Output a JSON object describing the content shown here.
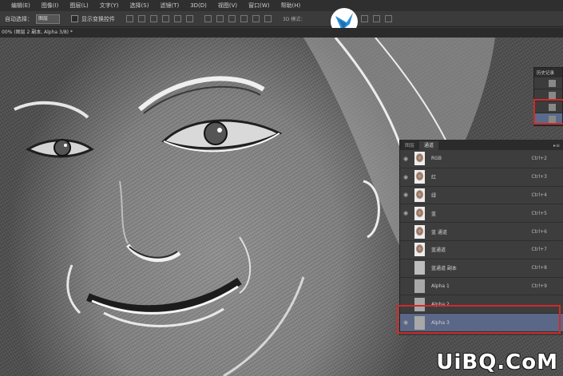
{
  "menu": {
    "items": [
      "编辑(E)",
      "图像(I)",
      "图层(L)",
      "文字(Y)",
      "选择(S)",
      "滤镜(T)",
      "3D(D)",
      "视图(V)",
      "窗口(W)",
      "帮助(H)"
    ]
  },
  "options": {
    "auto_select_label": "自动选择：",
    "auto_select_value": "图层",
    "show_transform_label": "显示变换控件",
    "mode_3d": "3D 模式："
  },
  "document": {
    "tab_title": "00% (图层 2 副本, Alpha 3/8) *"
  },
  "history_panel": {
    "title": "历史记录"
  },
  "channels_panel": {
    "tabs": [
      "图层",
      "通道"
    ],
    "active_tab": "通道",
    "channels": [
      {
        "name": "RGB",
        "shortcut": "Ctrl+2",
        "thumb": "face",
        "visible": true
      },
      {
        "name": "红",
        "shortcut": "Ctrl+3",
        "thumb": "face",
        "visible": true
      },
      {
        "name": "绿",
        "shortcut": "Ctrl+4",
        "thumb": "face",
        "visible": true
      },
      {
        "name": "蓝",
        "shortcut": "Ctrl+5",
        "thumb": "face",
        "visible": true
      },
      {
        "name": "蓝 通道",
        "shortcut": "Ctrl+6",
        "thumb": "face",
        "visible": false
      },
      {
        "name": "蓝通道",
        "shortcut": "Ctrl+7",
        "thumb": "face",
        "visible": false
      },
      {
        "name": "蓝通道 副本",
        "shortcut": "Ctrl+8",
        "thumb": "gray",
        "visible": false
      },
      {
        "name": "Alpha 1",
        "shortcut": "Ctrl+9",
        "thumb": "alpha",
        "visible": false
      },
      {
        "name": "Alpha 2",
        "shortcut": "",
        "thumb": "alpha",
        "visible": false
      },
      {
        "name": "Alpha 3",
        "shortcut": "",
        "thumb": "alpha",
        "visible": true,
        "selected": true
      }
    ]
  },
  "watermark": "UiBQ.CoM"
}
